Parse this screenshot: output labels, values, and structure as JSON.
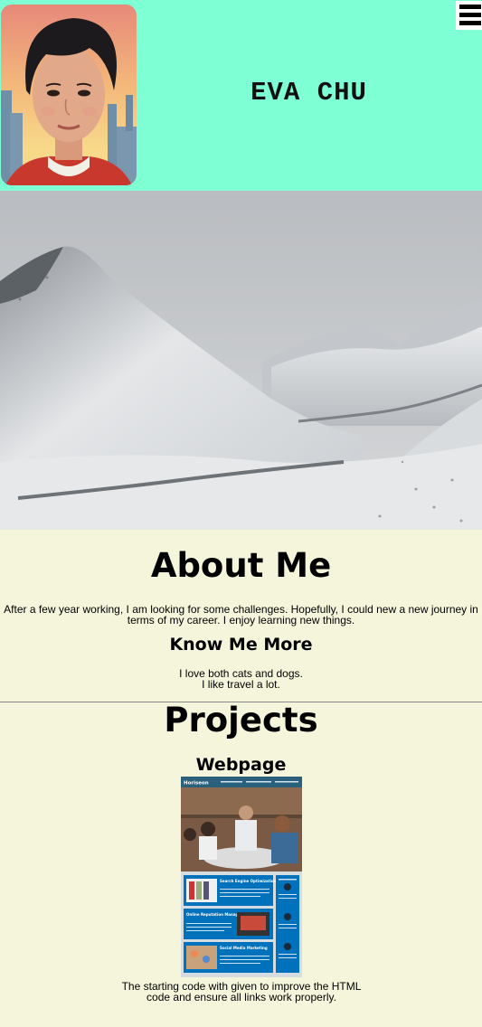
{
  "header": {
    "title": "EVA CHU",
    "avatar_alt": "avatar",
    "menu_icon": "hamburger-menu-icon"
  },
  "hero": {
    "alt": "Snowy mountain valley"
  },
  "about": {
    "heading": "About Me",
    "text_line1": "After a few year working, I am looking for some challenges. Hopefully, I could new a new journey in",
    "text_line2": "terms of my career. I enjoy learning new things.",
    "subheading": "Know Me More",
    "fact1": "I love both cats and dogs.",
    "fact2": "I like travel a lot."
  },
  "projects": {
    "heading": "Projects",
    "items": [
      {
        "title": "Webpage",
        "thumb": {
          "brand": "Horiseon",
          "nav": [
            "Search Engine Optimization",
            "Online Reputation Management",
            "Social Media Marketing"
          ],
          "cards": [
            "Search Engine Optimization",
            "Online Reputation Management",
            "Social Media Marketing"
          ]
        },
        "desc_line1": "The starting code with given to improve the HTML",
        "desc_line2": "code and ensure all links work properly."
      }
    ]
  },
  "colors": {
    "header_bg": "#7fffd4",
    "page_bg": "#f5f5dc",
    "thumb_blue": "#0072bb",
    "thumb_navy": "#2a607c"
  }
}
